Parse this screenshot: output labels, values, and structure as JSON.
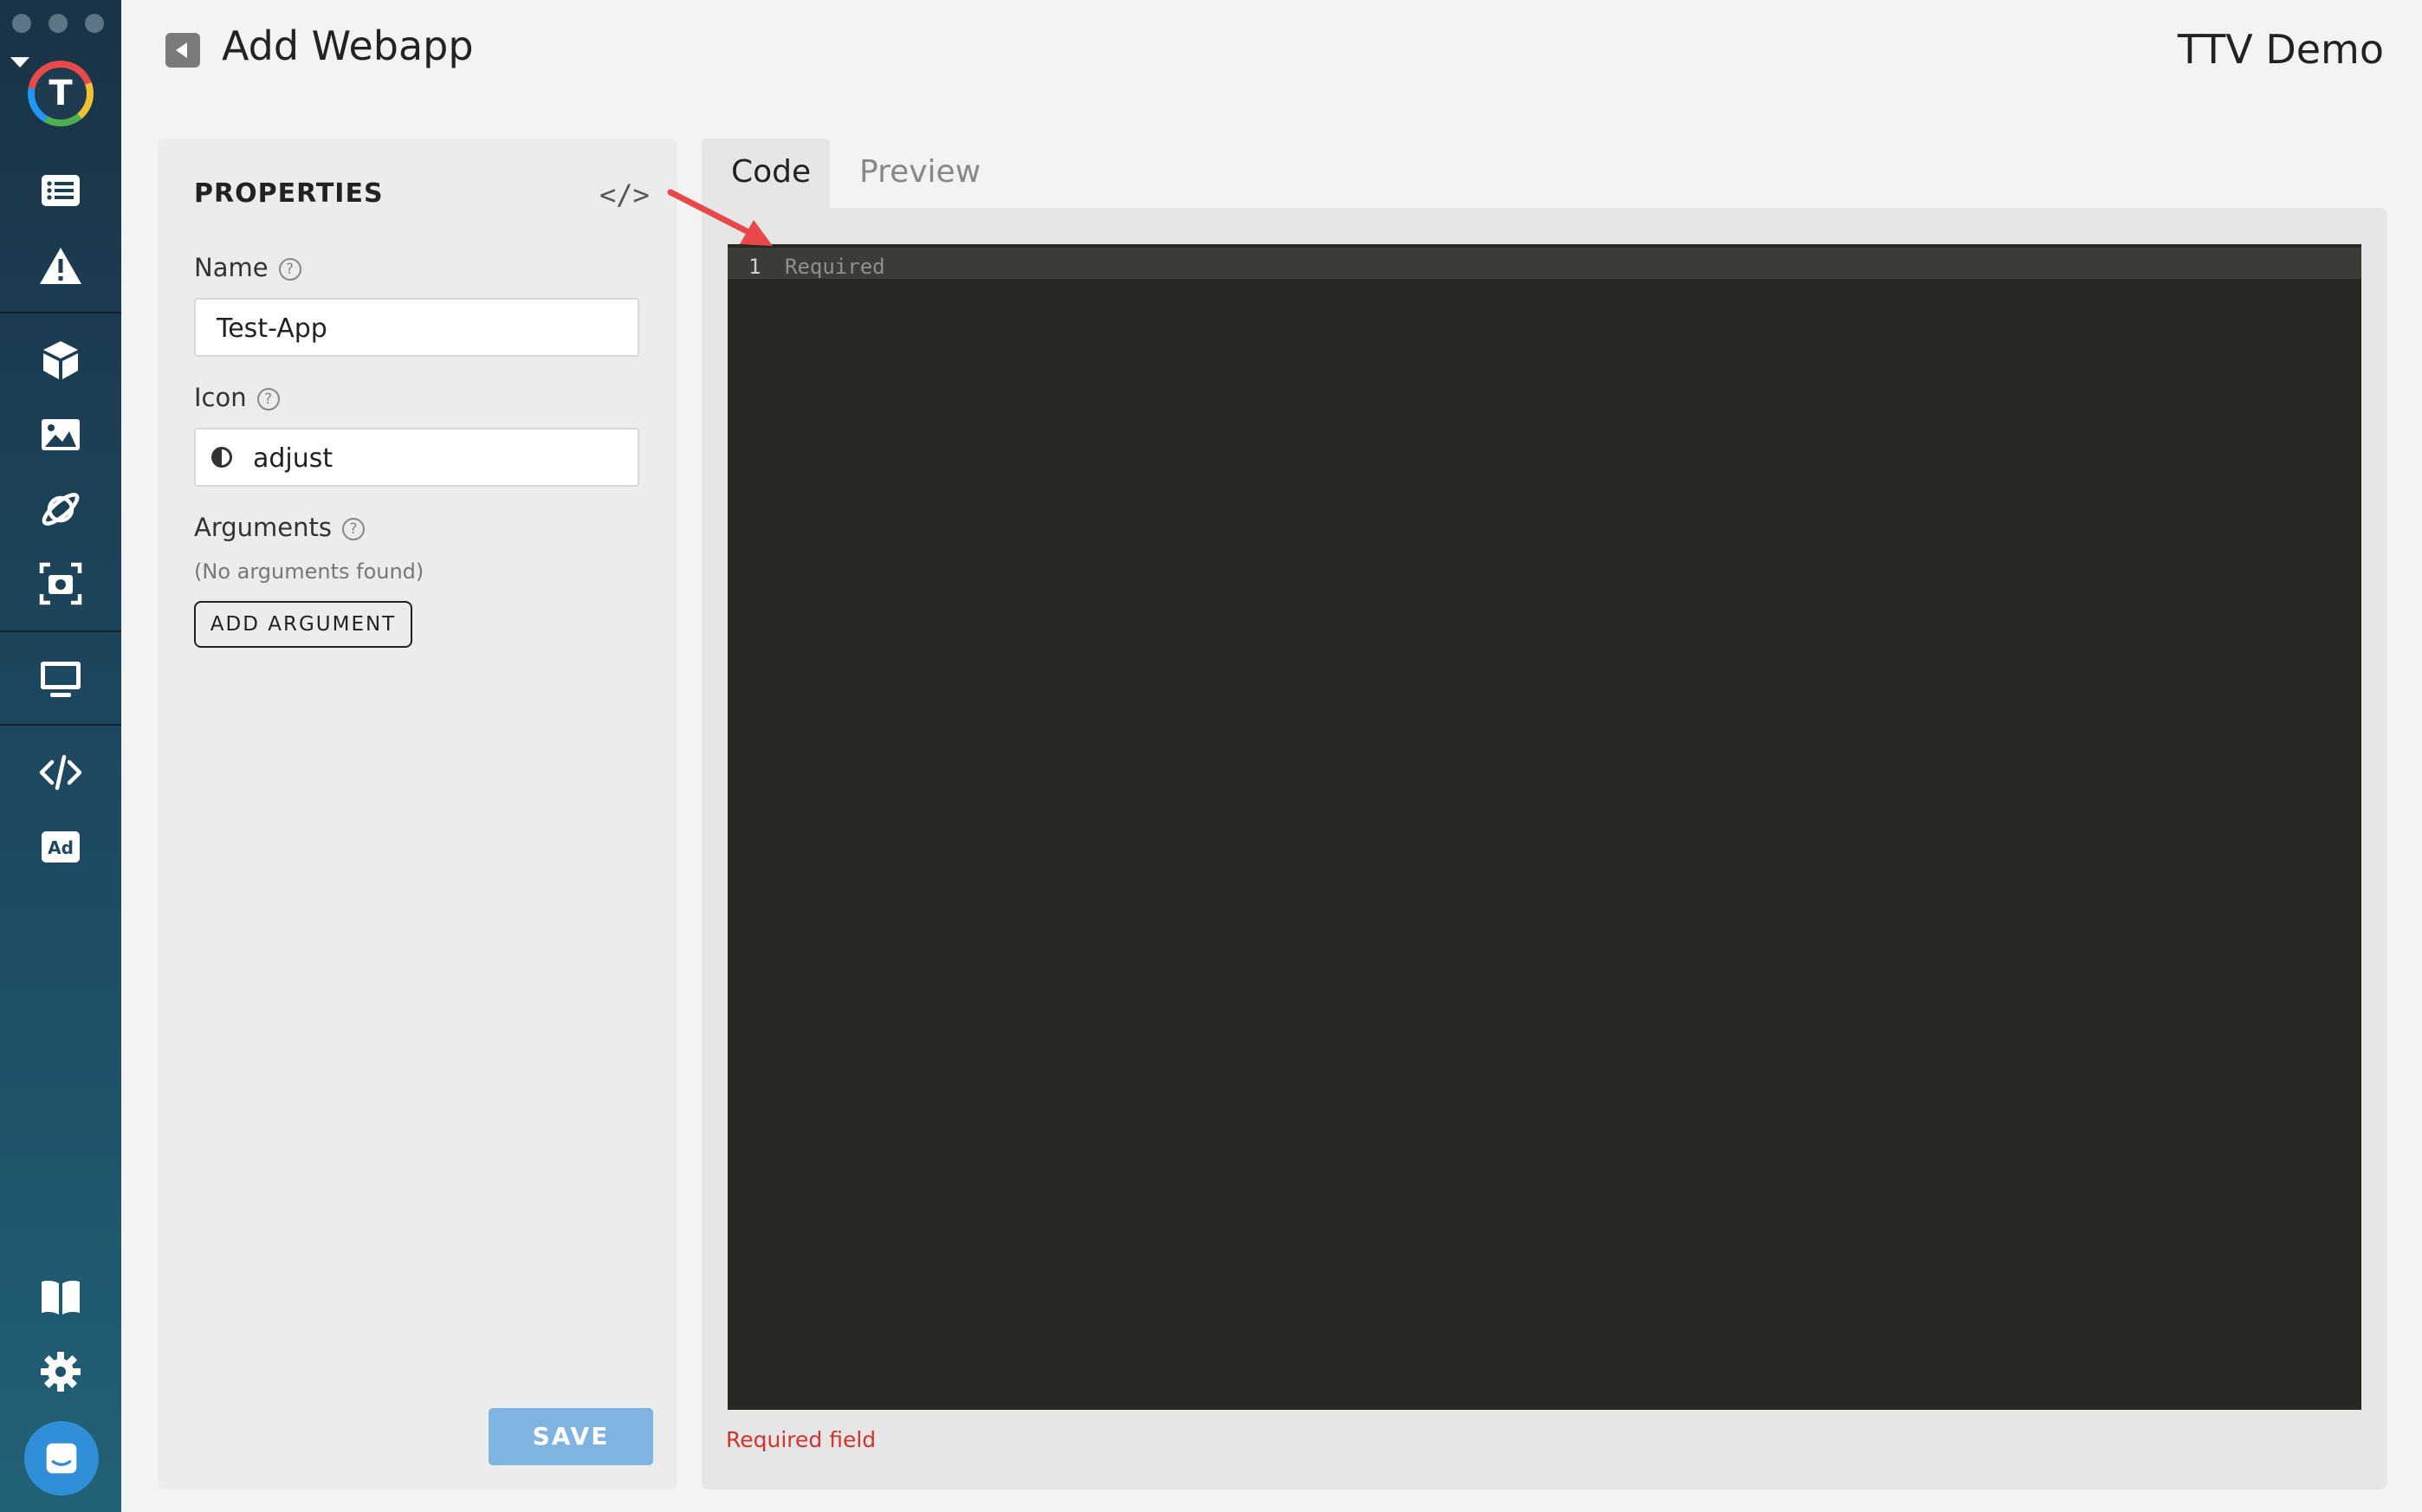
{
  "header": {
    "title": "Add Webapp",
    "workspace": "TTV Demo"
  },
  "sidebar": {
    "logo_letter": "T",
    "items": [
      {
        "name": "list-icon"
      },
      {
        "name": "warning-icon"
      },
      {
        "name": "cube-icon"
      },
      {
        "name": "image-icon"
      },
      {
        "name": "planet-icon"
      },
      {
        "name": "camera-icon"
      },
      {
        "name": "monitor-icon"
      },
      {
        "name": "code-icon"
      },
      {
        "name": "ad-icon"
      },
      {
        "name": "book-icon"
      },
      {
        "name": "gear-icon"
      },
      {
        "name": "chat-icon"
      }
    ],
    "ad_label": "Ad"
  },
  "properties": {
    "title": "PROPERTIES",
    "code_toggle": "</>",
    "name_label": "Name",
    "name_value": "Test-App",
    "icon_label": "Icon",
    "icon_value": "adjust",
    "arguments_label": "Arguments",
    "no_arguments": "(No arguments found)",
    "add_argument": "ADD ARGUMENT",
    "save": "SAVE",
    "help_glyph": "?"
  },
  "tabs": [
    {
      "label": "Code",
      "active": true
    },
    {
      "label": "Preview",
      "active": false
    }
  ],
  "editor": {
    "line_number": "1",
    "placeholder": "Required"
  },
  "error": "Required field",
  "colors": {
    "sidebar": "#1d4a62",
    "save_button": "#7fb3e0",
    "editor_bg": "#272822",
    "error": "#d0342c",
    "arrow": "#e8484a"
  }
}
